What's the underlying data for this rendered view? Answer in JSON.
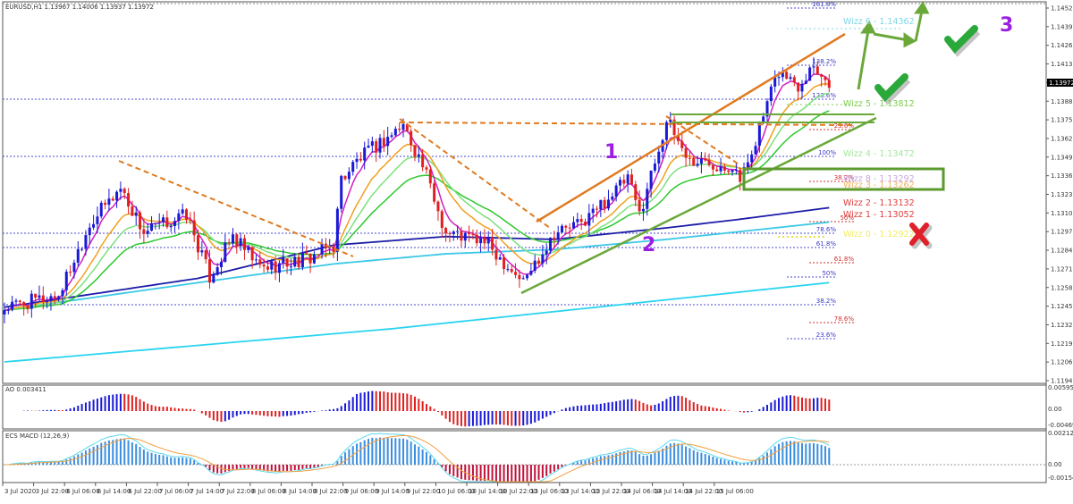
{
  "header": {
    "symbol_info": "EURUSD,H1  1.13967 1.14006 1.13937 1.13972"
  },
  "chart_data": {
    "type": "candlestick",
    "title": "EURUSD,H1",
    "ohlc_last": {
      "open": 1.13967,
      "high": 1.14006,
      "low": 1.13937,
      "close": 1.13972
    },
    "current_price_label": "1.13972",
    "ylim": [
      1.1194,
      1.14525
    ],
    "price_ticks": [
      "1.14525",
      "1.14395",
      "1.14265",
      "1.14135",
      "1.14010",
      "1.13880",
      "1.13750",
      "1.13620",
      "1.13490",
      "1.13360",
      "1.13230",
      "1.13100",
      "1.12970",
      "1.12840",
      "1.12710",
      "1.12580",
      "1.12450",
      "1.12320",
      "1.12190",
      "1.12065",
      "1.11940"
    ],
    "time_ticks": [
      "3 Jul 2020",
      "3 Jul 22:00",
      "6 Jul 06:00",
      "6 Jul 14:00",
      "6 Jul 22:00",
      "7 Jul 06:00",
      "7 Jul 14:00",
      "7 Jul 22:00",
      "8 Jul 06:00",
      "8 Jul 14:00",
      "8 Jul 22:00",
      "9 Jul 06:00",
      "9 Jul 14:00",
      "9 Jul 22:00",
      "10 Jul 06:00",
      "10 Jul 14:00",
      "10 Jul 22:00",
      "13 Jul 06:00",
      "13 Jul 14:00",
      "13 Jul 22:00",
      "14 Jul 06:00",
      "14 Jul 14:00",
      "14 Jul 22:00",
      "15 Jul 06:00"
    ],
    "price_path_hours_price": [
      [
        0,
        1.12442
      ],
      [
        14,
        1.12535
      ],
      [
        22,
        1.13031
      ],
      [
        30,
        1.13279
      ],
      [
        36,
        1.12969
      ],
      [
        47,
        1.13093
      ],
      [
        53,
        1.12659
      ],
      [
        59,
        1.12938
      ],
      [
        66,
        1.12721
      ],
      [
        78,
        1.12783
      ],
      [
        85,
        1.12876
      ],
      [
        87,
        1.13341
      ],
      [
        91,
        1.13465
      ],
      [
        103,
        1.13713
      ],
      [
        108,
        1.13434
      ],
      [
        114,
        1.12969
      ],
      [
        124,
        1.12907
      ],
      [
        134,
        1.12628
      ],
      [
        142,
        1.12969
      ],
      [
        149,
        1.13031
      ],
      [
        161,
        1.13341
      ],
      [
        164,
        1.13093
      ],
      [
        171,
        1.13744
      ],
      [
        177,
        1.13465
      ],
      [
        189,
        1.13434
      ],
      [
        190,
        1.1331
      ],
      [
        196,
        1.13775
      ],
      [
        200,
        1.14085
      ],
      [
        205,
        1.13992
      ],
      [
        209,
        1.14147
      ],
      [
        213,
        1.13972
      ]
    ],
    "moving_averages": [
      {
        "name": "navy-ma",
        "color": "#1c1ca8",
        "points": [
          [
            0,
            1.1245
          ],
          [
            50,
            1.1265
          ],
          [
            85,
            1.1288
          ],
          [
            114,
            1.1294
          ],
          [
            142,
            1.1292
          ],
          [
            171,
            1.13
          ],
          [
            190,
            1.1306
          ],
          [
            213,
            1.1314
          ]
        ]
      },
      {
        "name": "cyan-ma",
        "color": "#3cc8e6",
        "points": [
          [
            0,
            1.1243
          ],
          [
            50,
            1.1262
          ],
          [
            85,
            1.1275
          ],
          [
            114,
            1.1282
          ],
          [
            142,
            1.1285
          ],
          [
            171,
            1.1292
          ],
          [
            213,
            1.1304
          ]
        ]
      },
      {
        "name": "long-cyan-ma",
        "color": "#2ad4f0",
        "points": [
          [
            0,
            1.1207
          ],
          [
            100,
            1.123
          ],
          [
            213,
            1.1262
          ]
        ]
      }
    ],
    "ao": {
      "label": "AO 0.003411",
      "ticks": [
        "0.005958",
        "0.00",
        "-0.004693"
      ],
      "max": 0.005958,
      "min": -0.004693
    },
    "macd": {
      "label": "ECS MACD (12,26,9)",
      "ticks": [
        "0.0021248",
        "0.00",
        "-0.001547"
      ],
      "max": 0.0021248,
      "min": -0.001547
    },
    "fib_blue": [
      "161.8%",
      "138.2%",
      "123.6%",
      "100%",
      "78.6%",
      "61.8%",
      "50%",
      "38.2%",
      "23.6%"
    ],
    "fib_red": [
      "23.6%",
      "38.2%",
      "50%",
      "61.8%",
      "78.6%"
    ],
    "wizz_levels": [
      {
        "label": "Wizz 6 - 1.14362",
        "color": "#7fd7e8"
      },
      {
        "label": "Wizz 5 - 1.13812",
        "color": "#7ccd4f"
      },
      {
        "label": "Wizz 4 - 1.13472",
        "color": "#a6e6a0"
      },
      {
        "label": "Wizz 8 - 1.13292",
        "color": "#c9a8e0"
      },
      {
        "label": "Wizz 3 - 1.13262",
        "color": "#f0b060"
      },
      {
        "label": "Wizz 2 - 1.13132",
        "color": "#e03c3c"
      },
      {
        "label": "Wizz 1 - 1.13052",
        "color": "#e03c3c"
      },
      {
        "label": "Wizz 0 - 1.12922",
        "color": "#f0ee60"
      }
    ],
    "wave_labels": [
      "1",
      "2",
      "3"
    ],
    "colors": {
      "up": "#1a1ad6",
      "down": "#e02020",
      "ao_up": "#1a1ad6",
      "ao_down": "#e02020",
      "macd_pos": "#3a8ee0",
      "macd_neg": "#c0103a",
      "macd_line": "#5ad8ee",
      "signal_line": "#f0a040"
    }
  }
}
